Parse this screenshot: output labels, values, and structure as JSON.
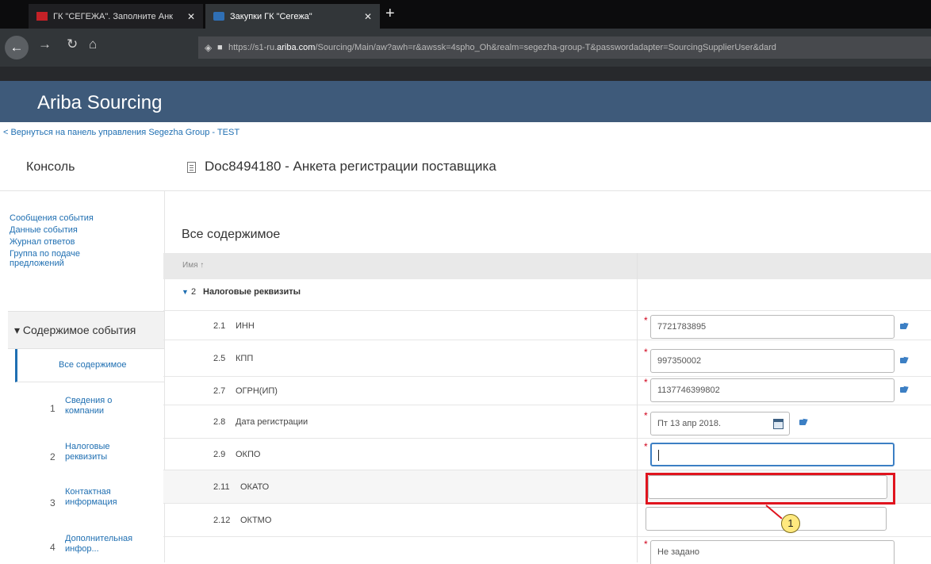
{
  "browser": {
    "tabs": [
      {
        "title": "ГК \"СЕГЕЖА\". Заполните Анк",
        "active": false
      },
      {
        "title": "Закупки ГК \"Сегежа\"",
        "active": true
      }
    ],
    "url_prefix": "https://s1-ru.",
    "url_host": "ariba.com",
    "url_rest": "/Sourcing/Main/aw?awh=r&awssk=4spho_Oh&realm=segezha-group-T&passwordadapter=SourcingSupplierUser&dard"
  },
  "app": {
    "title": "Ariba Sourcing",
    "back_link": "< Вернуться на панель управления Segezha Group - TEST"
  },
  "sidebar": {
    "console": "Консоль",
    "links": [
      "Сообщения события",
      "Данные события",
      "Журнал ответов",
      "Группа по подаче предложений"
    ],
    "section": "▾ Содержимое события",
    "active_item": "Все содержимое",
    "items": [
      {
        "num": "1",
        "label": "Сведения о компании"
      },
      {
        "num": "2",
        "label": "Налоговые реквизиты"
      },
      {
        "num": "3",
        "label": "Контактная информация"
      },
      {
        "num": "4",
        "label": "Дополнительная инфор..."
      }
    ]
  },
  "main": {
    "doc_title": "Doc8494180 - Анкета регистрации поставщика",
    "section_title": "Все содержимое",
    "column_name": "Имя ↑",
    "group": {
      "arrow": "▼",
      "num": "2",
      "label": "Налоговые реквизиты"
    },
    "rows": [
      {
        "num": "2.1",
        "label": "ИНН",
        "value": "7721783895",
        "required": true
      },
      {
        "num": "2.5",
        "label": "КПП",
        "value": "997350002",
        "required": true
      },
      {
        "num": "2.7",
        "label": "ОГРН(ИП)",
        "value": "1137746399802",
        "required": true
      },
      {
        "num": "2.8",
        "label": "Дата регистрации",
        "value": "Пт 13 апр 2018.",
        "required": true
      },
      {
        "num": "2.9",
        "label": "ОКПО",
        "value": "",
        "required": true
      },
      {
        "num": "2.11",
        "label": "ОКАТО",
        "value": "",
        "required": false
      },
      {
        "num": "2.12",
        "label": "ОКТМО",
        "value": "",
        "required": false
      }
    ],
    "last_select": "Не задано"
  },
  "annotation": {
    "callout": "1",
    "color": "#e0141e"
  }
}
